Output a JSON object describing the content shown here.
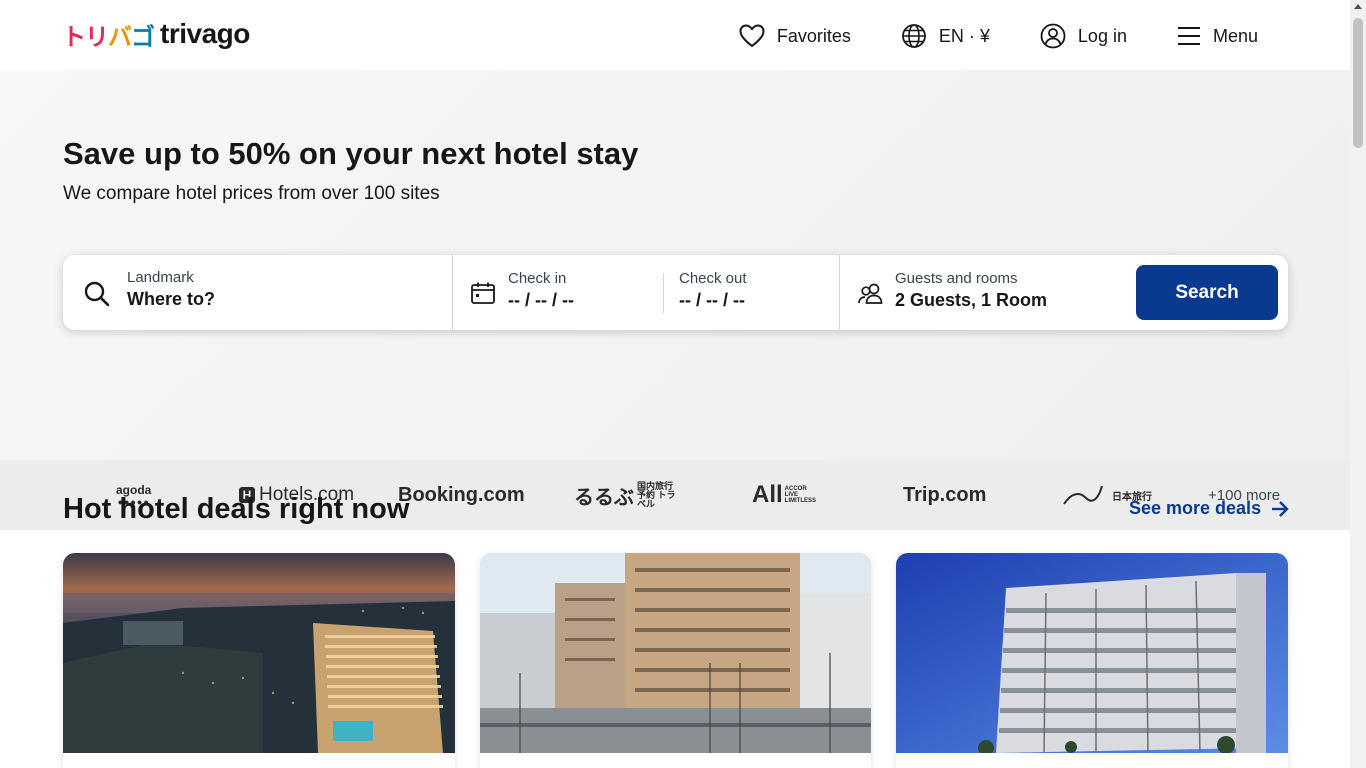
{
  "header": {
    "logo_jp": [
      "ト",
      "リ",
      "バ",
      "ゴ"
    ],
    "logo_en": "trivago",
    "favorites": "Favorites",
    "language": "EN · ¥",
    "login": "Log in",
    "menu": "Menu"
  },
  "hero": {
    "title": "Save up to 50% on your next hotel stay",
    "subtitle": "We compare hotel prices from over 100 sites"
  },
  "search": {
    "destination_label": "Landmark",
    "destination_value": "Where to?",
    "checkin_label": "Check in",
    "checkin_value": "-- / -- / --",
    "checkout_label": "Check out",
    "checkout_value": "-- / -- / --",
    "guests_label": "Guests and rooms",
    "guests_value": "2 Guests, 1 Room",
    "button": "Search"
  },
  "partners": {
    "agoda": "agoda",
    "agoda_dots": "●●●●●",
    "hotels": "Hotels.com",
    "hotels_mark": "H",
    "booking": "Booking.com",
    "rurubu": "るるぶ",
    "rurubu_sub": "国内旅行予約 トラベル",
    "accor": "All",
    "accor_sub": "ACCOR LIVE LIMITLESS",
    "trip": "Trip.com",
    "nippon": "日本旅行",
    "more": "+100 more"
  },
  "deals": {
    "title": "Hot hotel deals right now",
    "see_more": "See more deals"
  },
  "colors": {
    "brand_blue": "#0a3a90",
    "logo_red": "#e32851",
    "logo_orange": "#f48f00",
    "logo_blue": "#007fad"
  }
}
